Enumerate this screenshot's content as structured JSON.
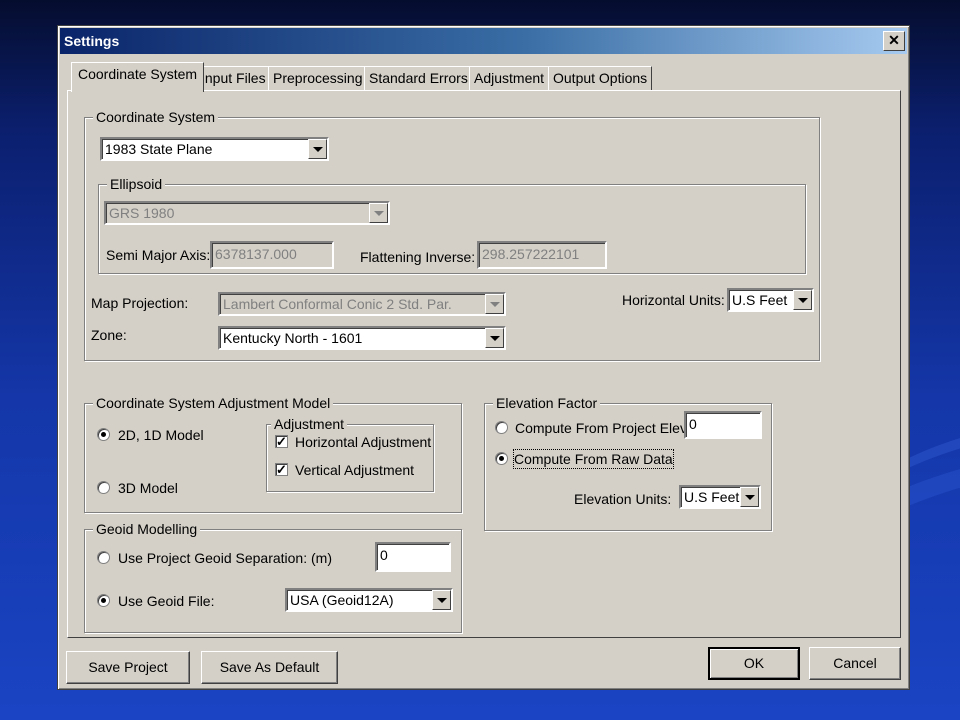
{
  "window": {
    "title": "Settings"
  },
  "tabs": [
    {
      "label": "Coordinate System",
      "active": true
    },
    {
      "label": "Input Files"
    },
    {
      "label": "Preprocessing"
    },
    {
      "label": "Standard Errors"
    },
    {
      "label": "Adjustment"
    },
    {
      "label": "Output Options"
    }
  ],
  "coordinate_system": {
    "group_label": "Coordinate System",
    "system_value": "1983 State Plane",
    "ellipsoid": {
      "group_label": "Ellipsoid",
      "value": "GRS 1980",
      "semi_major_label": "Semi Major Axis:",
      "semi_major_value": "6378137.000",
      "flattening_label": "Flattening Inverse:",
      "flattening_value": "298.257222101"
    },
    "map_projection_label": "Map Projection:",
    "map_projection_value": "Lambert Conformal Conic 2 Std. Par.",
    "zone_label": "Zone:",
    "zone_value": "Kentucky North - 1601",
    "horizontal_units_label": "Horizontal Units:",
    "horizontal_units_value": "U.S Feet"
  },
  "adjustment_model": {
    "group_label": "Coordinate System Adjustment Model",
    "model_2d_label": "2D, 1D Model",
    "model_2d_selected": true,
    "model_3d_label": "3D Model",
    "adjustment_group_label": "Adjustment",
    "horizontal_label": "Horizontal Adjustment",
    "horizontal_checked": true,
    "vertical_label": "Vertical Adjustment",
    "vertical_checked": true
  },
  "elevation_factor": {
    "group_label": "Elevation Factor",
    "project_elev_label": "Compute From Project Elev.",
    "project_elev_value": "0",
    "raw_data_label": "Compute From Raw Data",
    "raw_data_selected": true,
    "units_label": "Elevation Units:",
    "units_value": "U.S Feet"
  },
  "geoid": {
    "group_label": "Geoid Modelling",
    "separation_label": "Use Project Geoid Separation: (m)",
    "separation_value": "0",
    "file_label": "Use Geoid File:",
    "file_selected": true,
    "file_value": "USA (Geoid12A)"
  },
  "footer": {
    "save_project": "Save Project",
    "save_default": "Save As Default",
    "ok": "OK",
    "cancel": "Cancel"
  },
  "colors": {
    "background_top": "#050d2e",
    "background_bottom": "#1a44c4",
    "titlebar": "#0a246a",
    "dialog_face": "#d4d0c8"
  }
}
